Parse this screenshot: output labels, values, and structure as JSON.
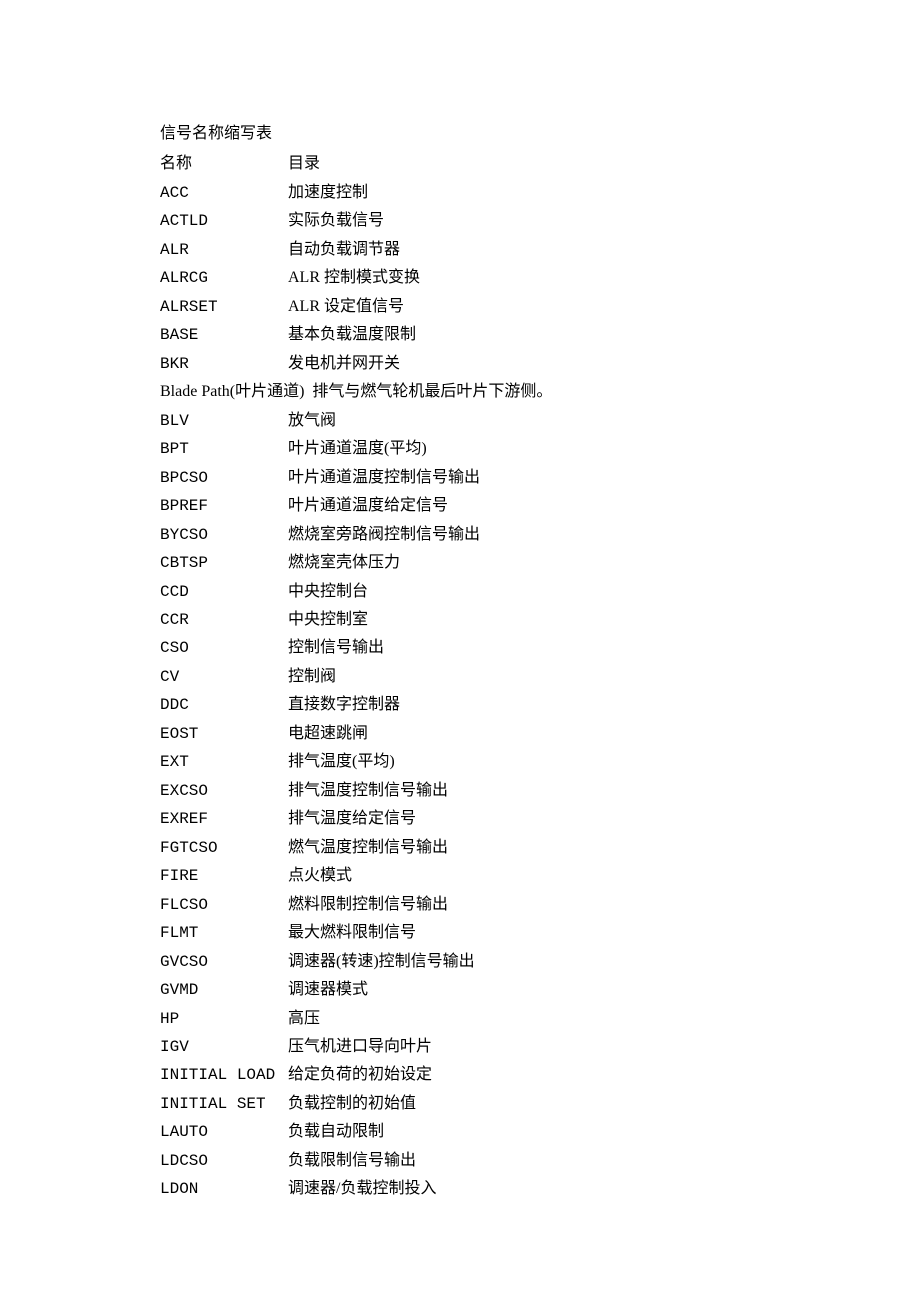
{
  "title": "信号名称缩写表",
  "header": {
    "name": "名称",
    "desc": "目录"
  },
  "entries": [
    {
      "name": "ACC",
      "desc": "加速度控制"
    },
    {
      "name": "ACTLD",
      "desc": "实际负载信号"
    },
    {
      "name": "ALR",
      "desc": "自动负载调节器"
    },
    {
      "name": "ALRCG",
      "desc": "ALR 控制模式变换"
    },
    {
      "name": "ALRSET",
      "desc": "ALR 设定值信号"
    },
    {
      "name": "BASE",
      "desc": "基本负载温度限制"
    },
    {
      "name": "BKR",
      "desc": "发电机并网开关"
    },
    {
      "full": "Blade Path(叶片通道)  排气与燃气轮机最后叶片下游侧。"
    },
    {
      "name": "BLV",
      "desc": "放气阀"
    },
    {
      "name": "BPT",
      "desc": "叶片通道温度(平均)"
    },
    {
      "name": "BPCSO",
      "desc": "叶片通道温度控制信号输出"
    },
    {
      "name": "BPREF",
      "desc": "叶片通道温度给定信号"
    },
    {
      "name": "BYCSO",
      "desc": "燃烧室旁路阀控制信号输出"
    },
    {
      "name": "CBTSP",
      "desc": "燃烧室壳体压力"
    },
    {
      "name": "CCD",
      "desc": "中央控制台"
    },
    {
      "name": "CCR",
      "desc": "中央控制室"
    },
    {
      "name": "CSO",
      "desc": "控制信号输出"
    },
    {
      "name": "CV",
      "desc": "控制阀"
    },
    {
      "name": "DDC",
      "desc": "直接数字控制器"
    },
    {
      "name": "EOST",
      "desc": "电超速跳闸"
    },
    {
      "name": "EXT",
      "desc": "排气温度(平均)"
    },
    {
      "name": "EXCSO",
      "desc": "排气温度控制信号输出"
    },
    {
      "name": "EXREF",
      "desc": "排气温度给定信号"
    },
    {
      "name": "FGTCSO",
      "desc": "燃气温度控制信号输出"
    },
    {
      "name": "FIRE",
      "desc": "点火模式"
    },
    {
      "name": "FLCSO",
      "desc": "燃料限制控制信号输出"
    },
    {
      "name": "FLMT",
      "desc": "最大燃料限制信号"
    },
    {
      "name": "GVCSO",
      "desc": "调速器(转速)控制信号输出"
    },
    {
      "name": "GVMD",
      "desc": "调速器模式"
    },
    {
      "name": "HP",
      "desc": "高压"
    },
    {
      "name": "IGV",
      "desc": "压气机进口导向叶片"
    },
    {
      "name": "INITIAL LOAD",
      "desc": "给定负荷的初始设定"
    },
    {
      "name": "INITIAL SET",
      "desc": "负载控制的初始值"
    },
    {
      "name": "LAUTO",
      "desc": "负载自动限制"
    },
    {
      "name": "LDCSO",
      "desc": "负载限制信号输出"
    },
    {
      "name": "LDON",
      "desc": "调速器/负载控制投入"
    }
  ]
}
